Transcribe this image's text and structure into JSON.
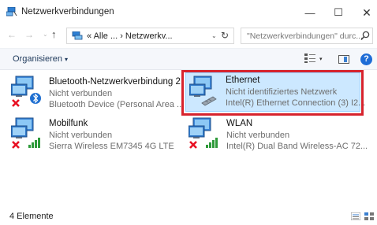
{
  "window": {
    "title": "Netzwerkverbindungen",
    "minimize": "—",
    "maximize": "☐",
    "close": "✕"
  },
  "nav": {
    "back": "←",
    "forward": "→",
    "recent": "⌄",
    "up": "↑"
  },
  "address": {
    "path": "« Alle ... › Netzwerkv...",
    "dropdown": "⌄",
    "refresh": "↻"
  },
  "search": {
    "placeholder": "\"Netzwerkverbindungen\" durc..."
  },
  "toolbar": {
    "organize_label": "Organisieren",
    "organize_caret": "▾",
    "view_caret": "▾",
    "help_label": "?"
  },
  "connections": [
    {
      "name": "Bluetooth-Netzwerkverbindung 2",
      "status": "Nicht verbunden",
      "device": "Bluetooth Device (Personal Area ...",
      "icon": "bluetooth-network-icon",
      "disconnected": true
    },
    {
      "name": "Ethernet",
      "status": "Nicht identifiziertes Netzwerk",
      "device": "Intel(R) Ethernet Connection (3) I2...",
      "icon": "ethernet-network-icon",
      "selected": true
    },
    {
      "name": "Mobilfunk",
      "status": "Nicht verbunden",
      "device": "Sierra Wireless EM7345 4G LTE",
      "icon": "cellular-network-icon",
      "disconnected": true
    },
    {
      "name": "WLAN",
      "status": "Nicht verbunden",
      "device": "Intel(R) Dual Band Wireless-AC 72...",
      "icon": "wlan-network-icon",
      "disconnected": true
    }
  ],
  "status": {
    "item_count": "4 Elemente"
  },
  "colors": {
    "selection": "#cce8ff",
    "highlight": "#d7232d",
    "disconnected_x": "#e81123",
    "signal": "#2e9a3a"
  }
}
